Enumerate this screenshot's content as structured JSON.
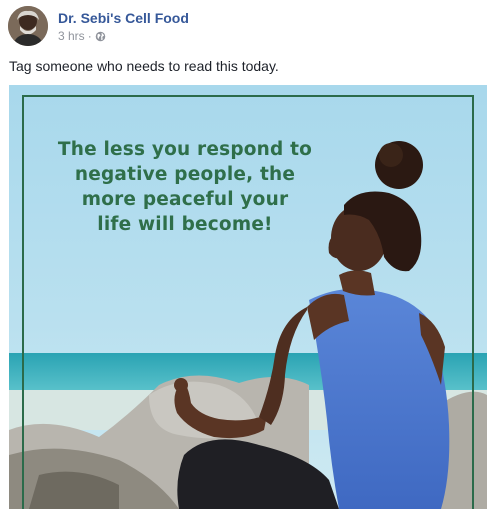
{
  "post": {
    "page_name": "Dr. Sebi's Cell Food",
    "timestamp": "3 hrs",
    "separator": "·",
    "privacy_icon": "globe-icon",
    "text": "Tag someone who needs to read this today.",
    "image": {
      "quote_lines": [
        "The less you respond to",
        "negative people, the",
        "more peaceful your",
        "life will become!"
      ]
    }
  },
  "colors": {
    "link_blue": "#365899",
    "meta_gray": "#90949c",
    "quote_green": "#2f6f4a",
    "frame_green": "#2b6b4a"
  }
}
